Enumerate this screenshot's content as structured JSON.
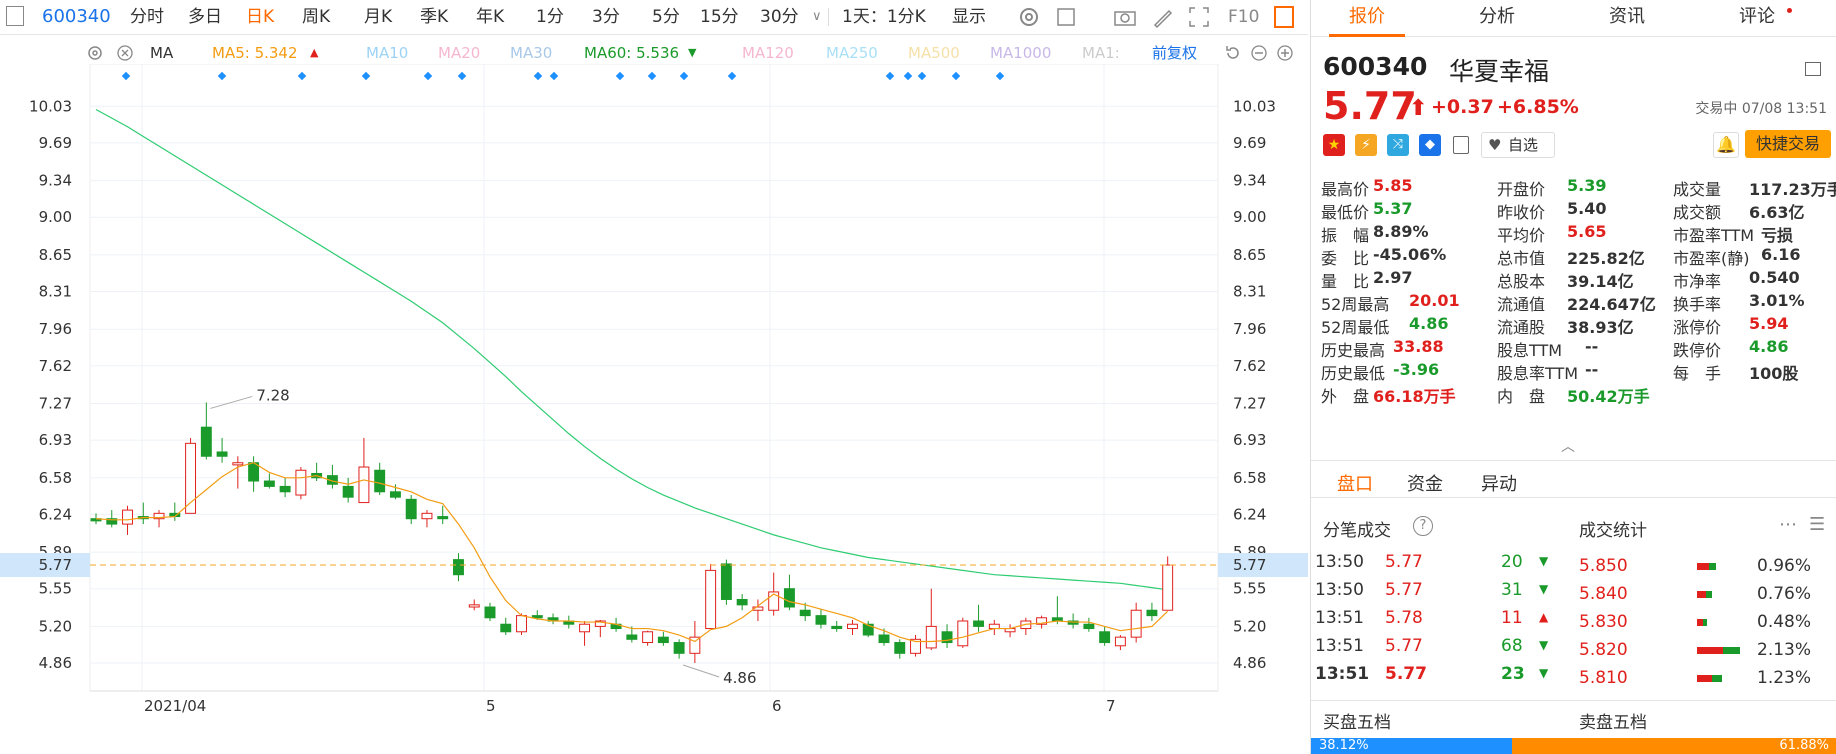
{
  "toolbar": {
    "code": "600340",
    "items": [
      "分时",
      "多日",
      "日K",
      "周K",
      "月K",
      "季K",
      "年K",
      "1分",
      "3分",
      "5分",
      "15分",
      "30分"
    ],
    "active_index": 2,
    "range_label": "1天：1分K",
    "show_label": "显示",
    "f10_label": "F10"
  },
  "ma_row": {
    "indicator": "MA",
    "ma5": "MA5: 5.342",
    "ma10": "MA10",
    "ma20": "MA20",
    "ma30": "MA30",
    "ma60": "MA60: 5.536",
    "ma120": "MA120",
    "ma250": "MA250",
    "ma500": "MA500",
    "ma1000": "MA1000",
    "ma_more": "MA1:",
    "adjust": "前复权"
  },
  "chart_data": {
    "type": "candlestick",
    "y_ticks": [
      "10.03",
      "9.69",
      "9.34",
      "9.00",
      "8.65",
      "8.31",
      "7.96",
      "7.62",
      "7.27",
      "6.93",
      "6.58",
      "6.24",
      "5.89",
      "5.55",
      "5.20",
      "4.86"
    ],
    "x_labels": [
      "2021/04",
      "5",
      "6",
      "7"
    ],
    "current_price_label": "5.77",
    "high_annotation": "7.28",
    "low_annotation": "4.86",
    "ylim": [
      4.6,
      10.2
    ],
    "candles": [
      [
        6.2,
        6.25,
        6.15,
        6.18
      ],
      [
        6.2,
        6.28,
        6.12,
        6.15
      ],
      [
        6.15,
        6.32,
        6.05,
        6.28
      ],
      [
        6.22,
        6.35,
        6.15,
        6.2
      ],
      [
        6.2,
        6.28,
        6.12,
        6.25
      ],
      [
        6.25,
        6.35,
        6.18,
        6.22
      ],
      [
        6.25,
        6.95,
        6.25,
        6.9
      ],
      [
        7.05,
        7.28,
        6.75,
        6.78
      ],
      [
        6.82,
        6.95,
        6.72,
        6.78
      ],
      [
        6.7,
        6.78,
        6.48,
        6.72
      ],
      [
        6.72,
        6.78,
        6.45,
        6.55
      ],
      [
        6.55,
        6.62,
        6.48,
        6.5
      ],
      [
        6.5,
        6.58,
        6.4,
        6.45
      ],
      [
        6.42,
        6.68,
        6.38,
        6.65
      ],
      [
        6.62,
        6.72,
        6.55,
        6.58
      ],
      [
        6.6,
        6.7,
        6.48,
        6.52
      ],
      [
        6.5,
        6.58,
        6.35,
        6.4
      ],
      [
        6.35,
        6.95,
        6.35,
        6.68
      ],
      [
        6.65,
        6.72,
        6.42,
        6.45
      ],
      [
        6.45,
        6.52,
        6.38,
        6.4
      ],
      [
        6.38,
        6.42,
        6.15,
        6.2
      ],
      [
        6.2,
        6.28,
        6.12,
        6.25
      ],
      [
        6.22,
        6.32,
        6.15,
        6.2
      ],
      [
        5.82,
        5.88,
        5.62,
        5.68
      ],
      [
        5.38,
        5.45,
        5.35,
        5.4
      ],
      [
        5.38,
        5.42,
        5.25,
        5.28
      ],
      [
        5.22,
        5.28,
        5.12,
        5.15
      ],
      [
        5.15,
        5.32,
        5.12,
        5.3
      ],
      [
        5.3,
        5.35,
        5.26,
        5.28
      ],
      [
        5.28,
        5.32,
        5.22,
        5.25
      ],
      [
        5.25,
        5.3,
        5.18,
        5.22
      ],
      [
        5.15,
        5.25,
        5.02,
        5.22
      ],
      [
        5.2,
        5.26,
        5.1,
        5.25
      ],
      [
        5.22,
        5.28,
        5.15,
        5.18
      ],
      [
        5.12,
        5.2,
        5.05,
        5.08
      ],
      [
        5.05,
        5.16,
        5.02,
        5.15
      ],
      [
        5.1,
        5.15,
        5.02,
        5.05
      ],
      [
        5.05,
        5.08,
        4.9,
        4.95
      ],
      [
        4.95,
        5.25,
        4.86,
        5.1
      ],
      [
        5.18,
        5.78,
        5.18,
        5.72
      ],
      [
        5.78,
        5.82,
        5.4,
        5.45
      ],
      [
        5.45,
        5.5,
        5.35,
        5.4
      ],
      [
        5.35,
        5.45,
        5.25,
        5.38
      ],
      [
        5.35,
        5.7,
        5.3,
        5.52
      ],
      [
        5.55,
        5.68,
        5.35,
        5.38
      ],
      [
        5.35,
        5.42,
        5.25,
        5.3
      ],
      [
        5.3,
        5.36,
        5.18,
        5.22
      ],
      [
        5.2,
        5.25,
        5.15,
        5.18
      ],
      [
        5.18,
        5.26,
        5.12,
        5.22
      ],
      [
        5.22,
        5.25,
        5.1,
        5.12
      ],
      [
        5.12,
        5.18,
        5.02,
        5.05
      ],
      [
        5.05,
        5.08,
        4.9,
        4.95
      ],
      [
        4.95,
        5.12,
        4.92,
        5.08
      ],
      [
        5.0,
        5.55,
        4.98,
        5.2
      ],
      [
        5.15,
        5.22,
        5.0,
        5.05
      ],
      [
        5.02,
        5.28,
        5.0,
        5.25
      ],
      [
        5.25,
        5.4,
        5.15,
        5.2
      ],
      [
        5.18,
        5.26,
        5.12,
        5.22
      ],
      [
        5.15,
        5.22,
        5.1,
        5.18
      ],
      [
        5.18,
        5.28,
        5.12,
        5.25
      ],
      [
        5.22,
        5.3,
        5.18,
        5.28
      ],
      [
        5.28,
        5.48,
        5.22,
        5.25
      ],
      [
        5.25,
        5.32,
        5.18,
        5.22
      ],
      [
        5.22,
        5.28,
        5.15,
        5.18
      ],
      [
        5.15,
        5.2,
        5.02,
        5.05
      ],
      [
        5.02,
        5.12,
        4.98,
        5.1
      ],
      [
        5.1,
        5.42,
        5.05,
        5.35
      ],
      [
        5.35,
        5.42,
        5.25,
        5.3
      ],
      [
        5.35,
        5.85,
        5.35,
        5.77
      ]
    ],
    "ma5": [
      6.2,
      6.19,
      6.19,
      6.21,
      6.21,
      6.22,
      6.35,
      6.47,
      6.59,
      6.68,
      6.72,
      6.63,
      6.58,
      6.58,
      6.6,
      6.55,
      6.52,
      6.56,
      6.53,
      6.49,
      6.45,
      6.38,
      6.34,
      6.15,
      5.93,
      5.66,
      5.44,
      5.3,
      5.27,
      5.25,
      5.25,
      5.24,
      5.24,
      5.22,
      5.18,
      5.18,
      5.16,
      5.12,
      5.06,
      5.17,
      5.2,
      5.28,
      5.39,
      5.5,
      5.43,
      5.4,
      5.36,
      5.32,
      5.28,
      5.21,
      5.16,
      5.1,
      5.06,
      5.06,
      5.07,
      5.1,
      5.14,
      5.18,
      5.18,
      5.22,
      5.23,
      5.25,
      5.24,
      5.24,
      5.2,
      5.16,
      5.18,
      5.2,
      5.34
    ],
    "ma60_start": 10.0,
    "ma60": [
      10.0,
      9.92,
      9.84,
      9.75,
      9.66,
      9.57,
      9.48,
      9.39,
      9.3,
      9.21,
      9.12,
      9.03,
      8.94,
      8.85,
      8.76,
      8.67,
      8.58,
      8.49,
      8.4,
      8.31,
      8.22,
      8.12,
      8.02,
      7.9,
      7.78,
      7.65,
      7.52,
      7.38,
      7.25,
      7.12,
      6.99,
      6.87,
      6.76,
      6.66,
      6.57,
      6.49,
      6.42,
      6.36,
      6.3,
      6.25,
      6.2,
      6.15,
      6.1,
      6.05,
      6.01,
      5.97,
      5.93,
      5.9,
      5.87,
      5.84,
      5.82,
      5.8,
      5.78,
      5.76,
      5.74,
      5.72,
      5.7,
      5.68,
      5.67,
      5.66,
      5.65,
      5.64,
      5.63,
      5.62,
      5.61,
      5.6,
      5.58,
      5.56,
      5.54
    ]
  },
  "panel": {
    "tabs": [
      "报价",
      "分析",
      "资讯",
      "评论"
    ],
    "code": "600340",
    "name": "华夏幸福",
    "price": "5.77",
    "change": "+0.37",
    "change_pct": "+6.85%",
    "status": "交易中 07/08 13:51",
    "watch_label": "自选",
    "quick_trade": "快捷交易",
    "stats": [
      [
        "最高价",
        "5.85",
        "red",
        "开盘价",
        "5.39",
        "green",
        "成交量",
        "117.23万手",
        "dark"
      ],
      [
        "最低价",
        "5.37",
        "green",
        "昨收价",
        "5.40",
        "dark",
        "成交额",
        "6.63亿",
        "dark"
      ],
      [
        "振　幅",
        "8.89%",
        "dark",
        "平均价",
        "5.65",
        "red",
        "市盈率TTM",
        "亏损",
        "dark"
      ],
      [
        "委　比",
        "-45.06%",
        "dark",
        "总市值",
        "225.82亿",
        "dark",
        "市盈率(静)",
        "6.16",
        "dark"
      ],
      [
        "量　比",
        "2.97",
        "dark",
        "总股本",
        "39.14亿",
        "dark",
        "市净率",
        "0.540",
        "dark"
      ],
      [
        "52周最高",
        "20.01",
        "red",
        "流通值",
        "224.647亿",
        "dark",
        "换手率",
        "3.01%",
        "dark"
      ],
      [
        "52周最低",
        "4.86",
        "green",
        "流通股",
        "38.93亿",
        "dark",
        "涨停价",
        "5.94",
        "red"
      ],
      [
        "历史最高",
        "33.88",
        "red",
        "股息TTM",
        "--",
        "dark",
        "跌停价",
        "4.86",
        "green"
      ],
      [
        "历史最低",
        "-3.96",
        "green",
        "股息率TTM",
        "--",
        "dark",
        "每　手",
        "100股",
        "dark"
      ],
      [
        "外　盘",
        "66.18万手",
        "red",
        "内　盘",
        "50.42万手",
        "green",
        "",
        "",
        ""
      ]
    ],
    "sub_tabs": [
      "盘口",
      "资金",
      "异动"
    ],
    "tick_title": "分笔成交",
    "stat_title": "成交统计",
    "ticks": [
      [
        "13:50",
        "5.77",
        "20",
        "down"
      ],
      [
        "13:50",
        "5.77",
        "31",
        "down"
      ],
      [
        "13:51",
        "5.78",
        "11",
        "up"
      ],
      [
        "13:51",
        "5.77",
        "68",
        "down"
      ],
      [
        "13:51",
        "5.77",
        "23",
        "down"
      ]
    ],
    "dist": [
      [
        "5.850",
        "0.96%",
        0.0096
      ],
      [
        "5.840",
        "0.76%",
        0.0076
      ],
      [
        "5.830",
        "0.48%",
        0.0048
      ],
      [
        "5.820",
        "2.13%",
        0.0213
      ],
      [
        "5.810",
        "1.23%",
        0.0123
      ]
    ],
    "bid_title": "买盘五档",
    "ask_title": "卖盘五档",
    "bid_pct": "38.12%",
    "ask_pct": "61.88%"
  },
  "colors": {
    "up": "#e0201c",
    "down": "#1a9a2a",
    "accent": "#ff6a00",
    "ma5": "#f39c12",
    "ma60": "#2ecc71",
    "link": "#1a73e8"
  }
}
